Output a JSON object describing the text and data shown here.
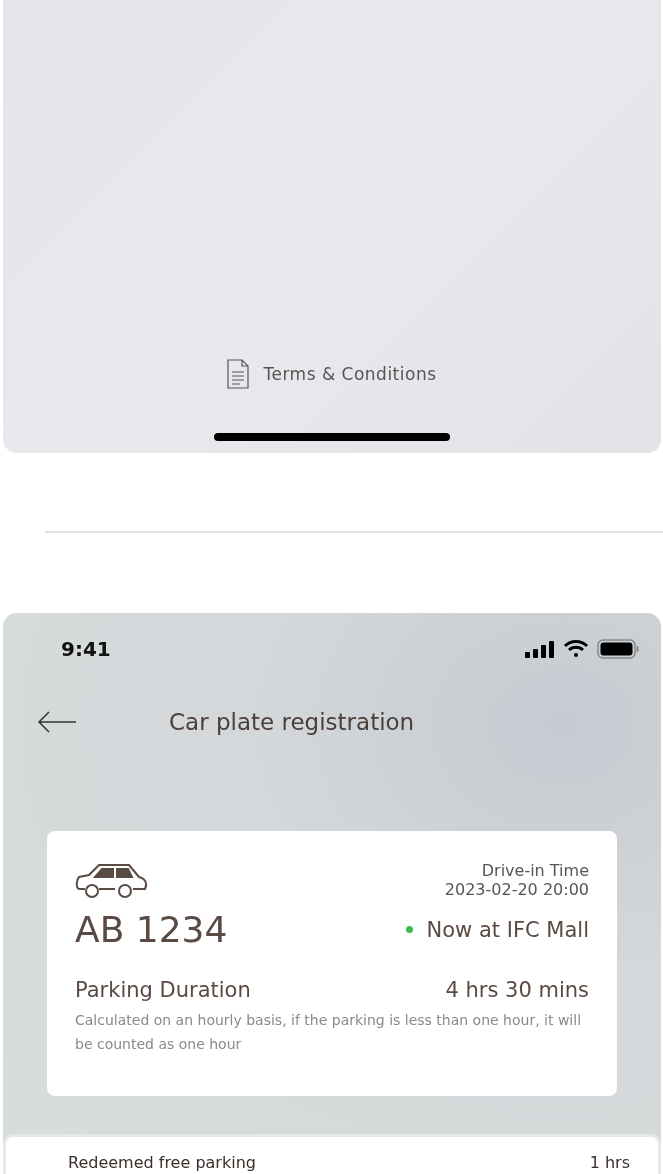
{
  "top_screen": {
    "terms_link": "Terms & Conditions"
  },
  "status_bar": {
    "time": "9:41"
  },
  "header": {
    "title": "Car plate registration"
  },
  "parking_card": {
    "drive_in_label": "Drive-in Time",
    "drive_in_time": "2023-02-20 20:00",
    "plate": "AB 1234",
    "location": {
      "text": "Now at IFC Mall",
      "color": "#3cba4c"
    },
    "duration_label": "Parking Duration",
    "duration_value": "4 hrs 30 mins",
    "note": "Calculated on an hourly basis, if the parking is less than one hour, it will be counted as one hour"
  },
  "redeem_sheet": {
    "label": "Redeemed free parking",
    "value": "1 hrs"
  }
}
